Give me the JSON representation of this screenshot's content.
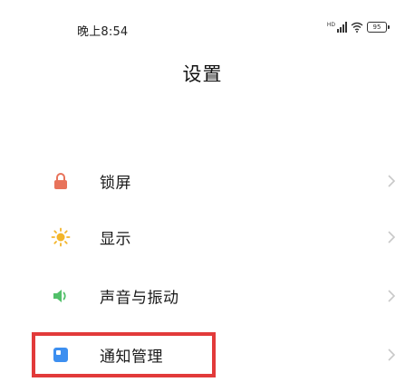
{
  "status_bar": {
    "time": "晚上8:54",
    "signal_label": "HD",
    "battery_level": "95"
  },
  "header": {
    "title": "设置"
  },
  "settings_items": [
    {
      "label": "锁屏",
      "icon": "lock-icon",
      "icon_color": "#e8735b"
    },
    {
      "label": "显示",
      "icon": "sun-icon",
      "icon_color": "#f3b52a"
    },
    {
      "label": "声音与振动",
      "icon": "speaker-icon",
      "icon_color": "#52c06a"
    },
    {
      "label": "通知管理",
      "icon": "notification-icon",
      "icon_color": "#3d8ff0"
    }
  ],
  "highlight": {
    "target": "通知管理",
    "color": "#e23a3a"
  }
}
